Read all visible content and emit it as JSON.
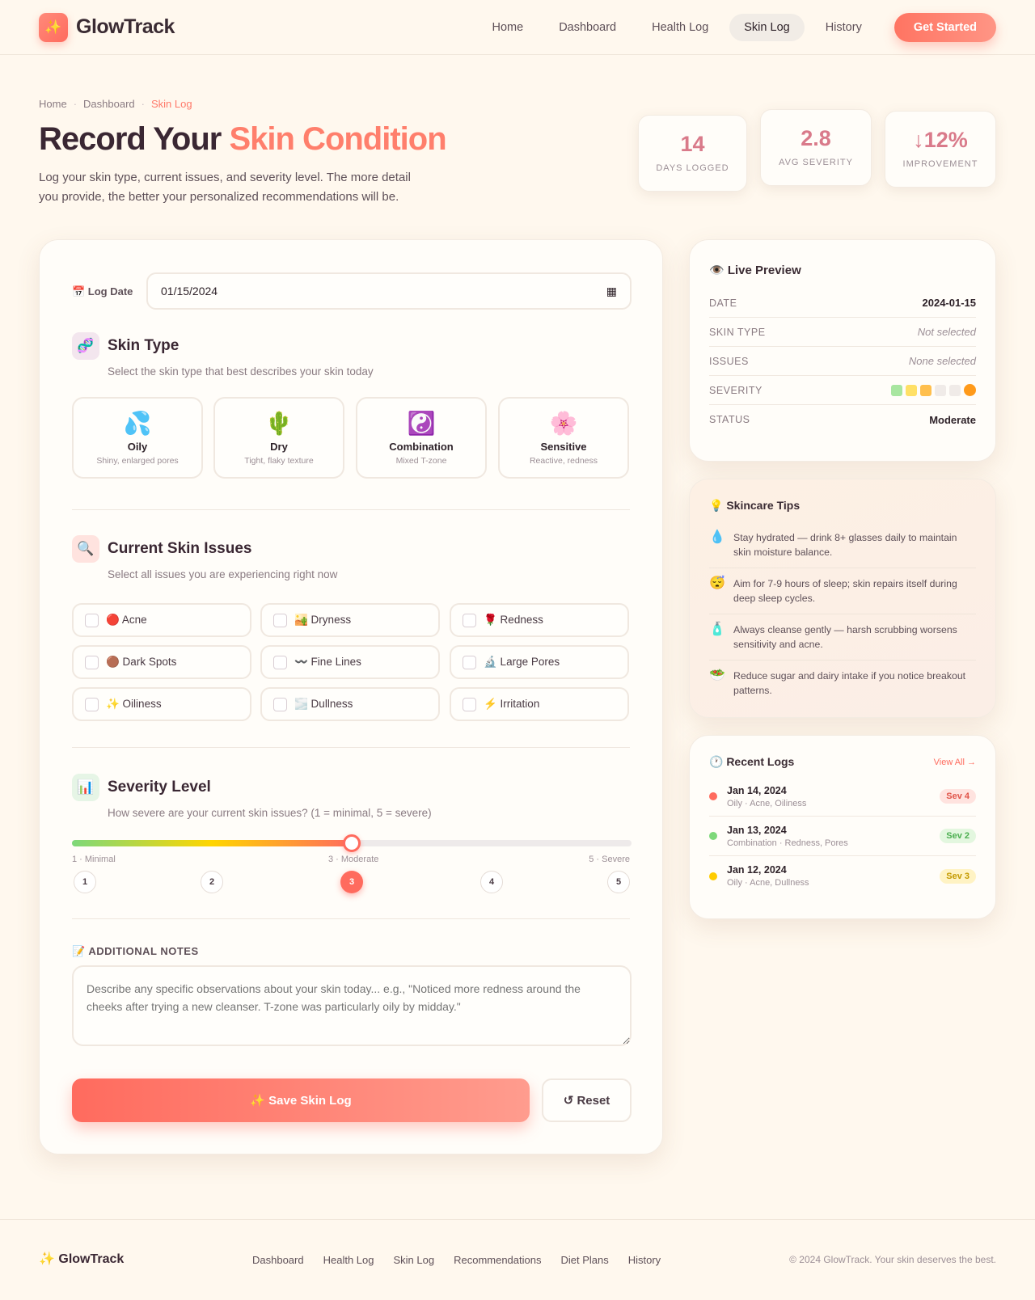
{
  "nav": {
    "brand": "GlowTrack",
    "logo_icon": "✨",
    "links": [
      "Home",
      "Dashboard",
      "Health Log",
      "Skin Log",
      "History"
    ],
    "active": "Skin Log",
    "cta": "Get Started"
  },
  "breadcrumb": [
    "Home",
    "Dashboard",
    "Skin Log"
  ],
  "header": {
    "title_a": "Record Your ",
    "title_b": "Skin Condition",
    "subtitle": "Log your skin type, current issues, and severity level. The more detail you provide, the better your personalized recommendations will be."
  },
  "stats": [
    {
      "value": "14",
      "label": "DAYS LOGGED"
    },
    {
      "value": "2.8",
      "label": "AVG SEVERITY"
    },
    {
      "value": "↓12%",
      "label": "IMPROVEMENT"
    }
  ],
  "form": {
    "date_label": "📅 Log Date",
    "date_value": "01/15/2024",
    "skin_type": {
      "icon": "🧬",
      "title": "Skin Type",
      "subtitle": "Select the skin type that best describes your skin today",
      "options": [
        {
          "emoji": "💦",
          "name": "Oily",
          "desc": "Shiny, enlarged pores"
        },
        {
          "emoji": "🌵",
          "name": "Dry",
          "desc": "Tight, flaky texture"
        },
        {
          "emoji": "☯️",
          "name": "Combination",
          "desc": "Mixed T-zone"
        },
        {
          "emoji": "🌸",
          "name": "Sensitive",
          "desc": "Reactive, redness"
        }
      ]
    },
    "issues": {
      "icon": "🔍",
      "title": "Current Skin Issues",
      "subtitle": "Select all issues you are experiencing right now",
      "options": [
        "🔴 Acne",
        "🏜️ Dryness",
        "🌹 Redness",
        "🟤 Dark Spots",
        "〰️ Fine Lines",
        "🔬 Large Pores",
        "✨ Oiliness",
        "🌫️ Dullness",
        "⚡ Irritation"
      ]
    },
    "severity": {
      "icon": "📊",
      "title": "Severity Level",
      "subtitle": "How severe are your current skin issues? (1 = minimal, 5 = severe)",
      "min_label": "1 · Minimal",
      "mid_label": "3 · Moderate",
      "max_label": "5 · Severe",
      "levels": [
        "1",
        "2",
        "3",
        "4",
        "5"
      ],
      "value": 3,
      "fraction": 0.5
    },
    "notes": {
      "label": "📝 ADDITIONAL NOTES",
      "placeholder": "Describe any specific observations about your skin today... e.g., \"Noticed more redness around the cheeks after trying a new cleanser. T-zone was particularly oily by midday.\""
    },
    "save": "✨ Save Skin Log",
    "reset": "↺ Reset"
  },
  "preview": {
    "title": "👁️ Live Preview",
    "rows": [
      {
        "k": "DATE",
        "v": "2024-01-15"
      },
      {
        "k": "SKIN TYPE",
        "v": "Not selected"
      },
      {
        "k": "ISSUES",
        "v": "None selected"
      },
      {
        "k": "SEVERITY",
        "v": ""
      },
      {
        "k": "STATUS",
        "v": "Moderate"
      }
    ],
    "severity_colors": [
      "#a8e6a0",
      "#ffe066",
      "#ffbf4d",
      "#f0ebe8",
      "#f0ebe8"
    ],
    "severity_dot": "#ff9a1a"
  },
  "tips": {
    "title": "💡 Skincare Tips",
    "items": [
      {
        "icon": "💧",
        "text": "Stay hydrated — drink 8+ glasses daily to maintain skin moisture balance."
      },
      {
        "icon": "😴",
        "text": "Aim for 7-9 hours of sleep; skin repairs itself during deep sleep cycles."
      },
      {
        "icon": "🧴",
        "text": "Always cleanse gently — harsh scrubbing worsens sensitivity and acne."
      },
      {
        "icon": "🥗",
        "text": "Reduce sugar and dairy intake if you notice breakout patterns."
      }
    ]
  },
  "recent": {
    "title": "🕐 Recent Logs",
    "view_all": "View All →",
    "items": [
      {
        "date": "Jan 14, 2024",
        "desc": "Oily · Acne, Oiliness",
        "badge": "Sev 4",
        "color": "#ff6b5e",
        "bg": "#ffe3df",
        "fg": "#e0554a"
      },
      {
        "date": "Jan 13, 2024",
        "desc": "Combination · Redness, Pores",
        "badge": "Sev 2",
        "color": "#7dd87a",
        "bg": "#e3f7df",
        "fg": "#4caf50"
      },
      {
        "date": "Jan 12, 2024",
        "desc": "Oily · Acne, Dullness",
        "badge": "Sev 3",
        "color": "#ffcc00",
        "bg": "#fff3c4",
        "fg": "#c49a00"
      }
    ]
  },
  "footer": {
    "brand": "✨ GlowTrack",
    "links": [
      "Dashboard",
      "Health Log",
      "Skin Log",
      "Recommendations",
      "Diet Plans",
      "History"
    ],
    "copyright": "© 2024 GlowTrack. Your skin deserves the best."
  }
}
